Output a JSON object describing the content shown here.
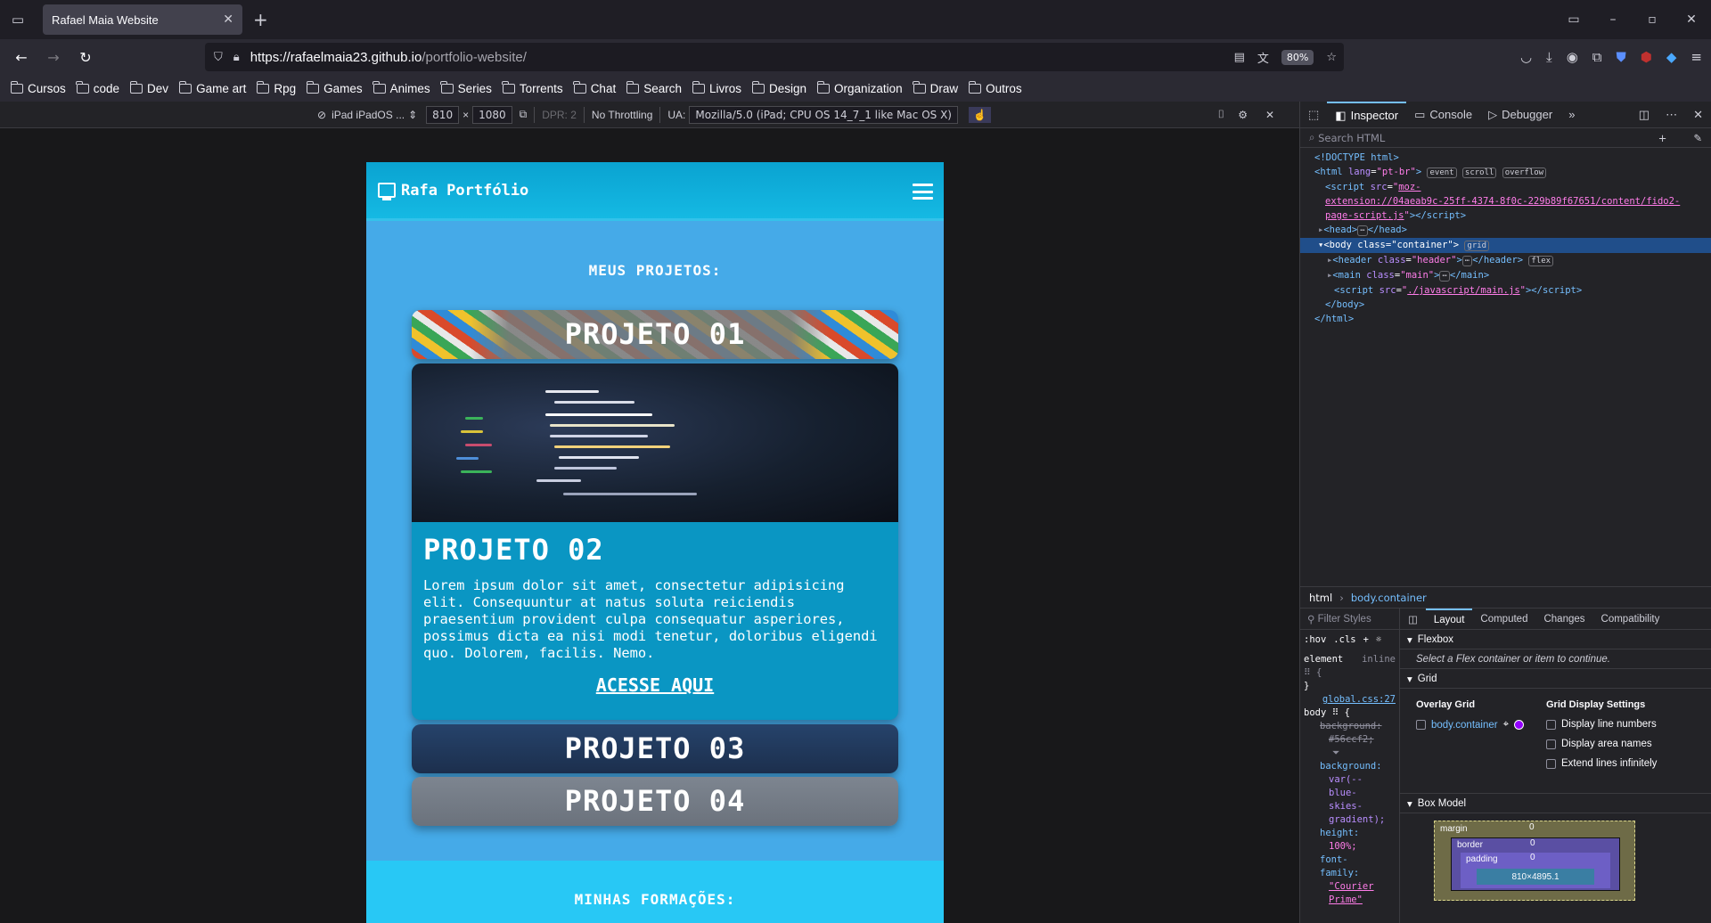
{
  "browser": {
    "tab_title": "Rafael Maia Website",
    "url_domain": "https://rafaelmaia23.github.io",
    "url_path": "/portfolio-website/",
    "zoom": "80%",
    "bookmarks": [
      "Cursos",
      "code",
      "Dev",
      "Game art",
      "Rpg",
      "Games",
      "Animes",
      "Series",
      "Torrents",
      "Chat",
      "Search",
      "Livros",
      "Design",
      "Organization",
      "Draw",
      "Outros"
    ]
  },
  "rdm": {
    "device": "iPad iPadOS ...",
    "width": "810",
    "times": "×",
    "height": "1080",
    "dpr": "DPR: 2",
    "throttling": "No Throttling",
    "ua_label": "UA:",
    "ua_value": "Mozilla/5.0 (iPad; CPU OS 14_7_1 like Mac OS X)"
  },
  "site": {
    "title": "Rafa Portfólio",
    "projects_heading": "MEUS PROJETOS:",
    "project1": "PROJETO 01",
    "project2": "PROJETO 02",
    "project2_text": "Lorem ipsum dolor sit amet, consectetur adipisicing elit. Consequuntur at natus soluta reiciendis praesentium provident culpa consequatur asperiores, possimus dicta ea nisi modi tenetur, doloribus eligendi quo. Dolorem, facilis. Nemo.",
    "project2_link": "ACESSE AQUI",
    "project3": "PROJETO 03",
    "project4": "PROJETO 04",
    "formations_heading": "MINHAS FORMAÇÕES:"
  },
  "devtools": {
    "tabs": [
      "Inspector",
      "Console",
      "Debugger"
    ],
    "search_placeholder": "Search HTML",
    "breadcrumb": [
      "html",
      "body.container"
    ],
    "filter_placeholder": "Filter Styles",
    "hov": ":hov",
    "cls": ".cls",
    "panel_tabs": [
      "Layout",
      "Computed",
      "Changes",
      "Compatibility"
    ],
    "flexbox_title": "Flexbox",
    "flexbox_msg": "Select a Flex container or item to continue.",
    "grid_title": "Grid",
    "overlay_grid": "Overlay Grid",
    "grid_item": "body.container",
    "grid_settings": "Grid Display Settings",
    "settings": [
      "Display line numbers",
      "Display area names",
      "Extend lines infinitely"
    ],
    "box_model": "Box Model",
    "bm_margin": "margin",
    "bm_border": "border",
    "bm_padding": "padding",
    "bm_size": "810×4895.1",
    "bm_zero": "0",
    "rules": {
      "element": "element",
      "inline": "inline",
      "source": "global.css:27",
      "selector": "body",
      "prop1": "background:",
      "val1": "#56ccf2;",
      "prop2": "background:",
      "val2": "var(--blue-skies-gradient);",
      "prop3": "height:",
      "val3": "100%;",
      "prop4": "font-family:",
      "val4": "\"Courier Prime\""
    }
  }
}
